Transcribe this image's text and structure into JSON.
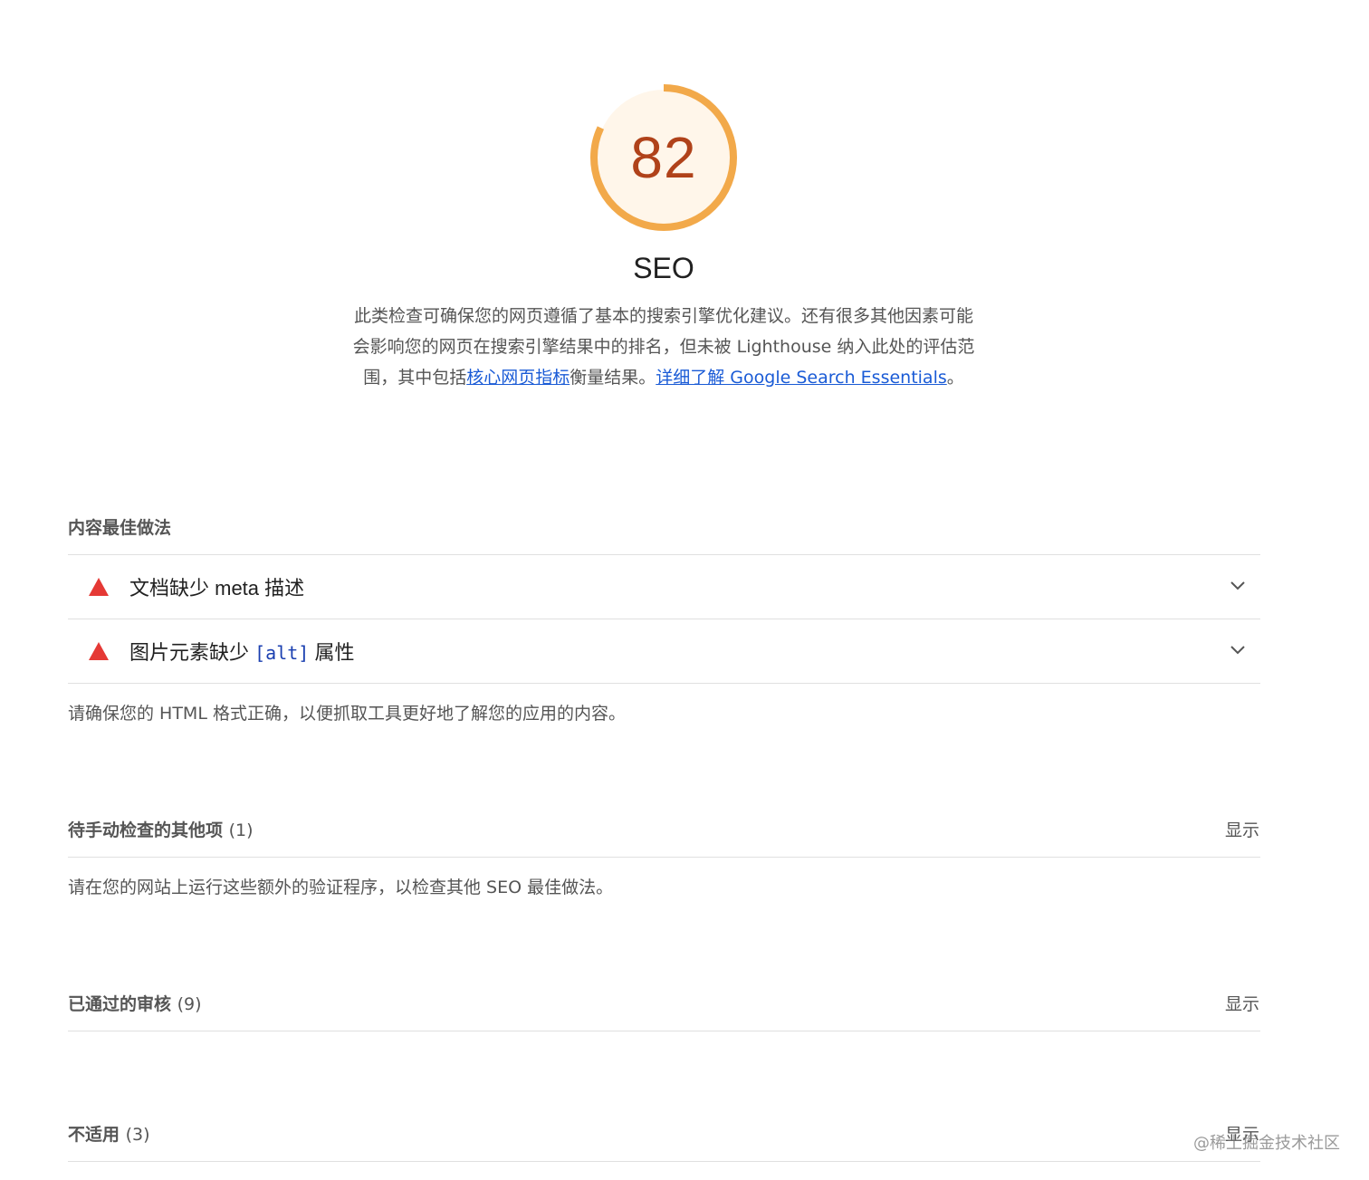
{
  "gauge": {
    "score": "82",
    "score_fraction": 0.82,
    "colors": {
      "arc": "#f2a94a",
      "fill": "#fff6ea",
      "text": "#b0421a"
    }
  },
  "category": {
    "title": "SEO",
    "desc_part1": "此类检查可确保您的网页遵循了基本的搜索引擎优化建议。还有很多其他因素可能会影响您的网页在搜索引擎结果中的排名，但未被 Lighthouse 纳入此处的评估范围，其中包括",
    "core_vitals_link": "核心网页指标",
    "desc_part2": "衡量结果。",
    "learn_more_link": "详细了解 Google Search Essentials",
    "desc_end": "。",
    "link_color": "#1a5bd6"
  },
  "groups": {
    "content": {
      "title": "内容最佳做法",
      "audits": [
        {
          "label": "文档缺少 meta 描述",
          "icon": "warning-triangle-icon",
          "status_color": "#e53935"
        },
        {
          "label_before": "图片元素缺少 ",
          "code": "[alt]",
          "label_after": " 属性",
          "icon": "warning-triangle-icon",
          "status_color": "#e53935"
        }
      ],
      "description": "请确保您的 HTML 格式正确，以便抓取工具更好地了解您的应用的内容。"
    },
    "manual": {
      "title": "待手动检查的其他项",
      "count": "(1)",
      "show": "显示",
      "description": "请在您的网站上运行这些额外的验证程序，以检查其他 SEO 最佳做法。"
    },
    "passed": {
      "title": "已通过的审核",
      "count": "(9)",
      "show": "显示"
    },
    "not_applicable": {
      "title": "不适用",
      "count": "(3)",
      "show": "显示"
    }
  },
  "watermark": "@稀土掘金技术社区"
}
